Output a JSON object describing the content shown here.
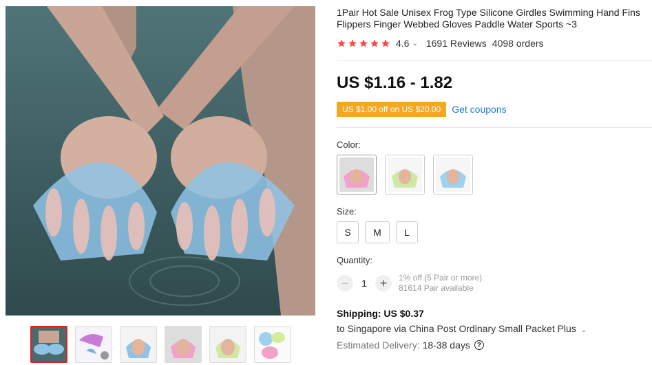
{
  "product": {
    "title": "1Pair Hot Sale Unisex Frog Type Silicone Girdles Swimming Hand Fins Flippers Finger Webbed Gloves Paddle Water Sports ~3",
    "rating": "4.6",
    "reviews": "1691 Reviews",
    "orders": "4098 orders",
    "price": "US $1.16 - 1.82",
    "coupon": "US $1.00 off on US $20.00",
    "get_coupons": "Get coupons"
  },
  "color": {
    "label": "Color:",
    "swatches": [
      "pink-gloves",
      "green-gloves",
      "blue-gloves"
    ]
  },
  "size": {
    "label": "Size:",
    "options": [
      "S",
      "M",
      "L"
    ]
  },
  "quantity": {
    "label": "Quantity:",
    "value": "1",
    "discount": "1% off (5 Pair or more)",
    "available": "81614 Pair available"
  },
  "shipping": {
    "title": "Shipping: US $0.37",
    "destination": "to Singapore via China Post Ordinary Small Packet Plus",
    "delivery_label": "Estimated Delivery:",
    "delivery_days": "18-38 days"
  },
  "colors": {
    "star": "#ff4747",
    "coupon_bg": "#f5a623",
    "link": "#1e7bd0",
    "active_thumb": "#e02020"
  }
}
